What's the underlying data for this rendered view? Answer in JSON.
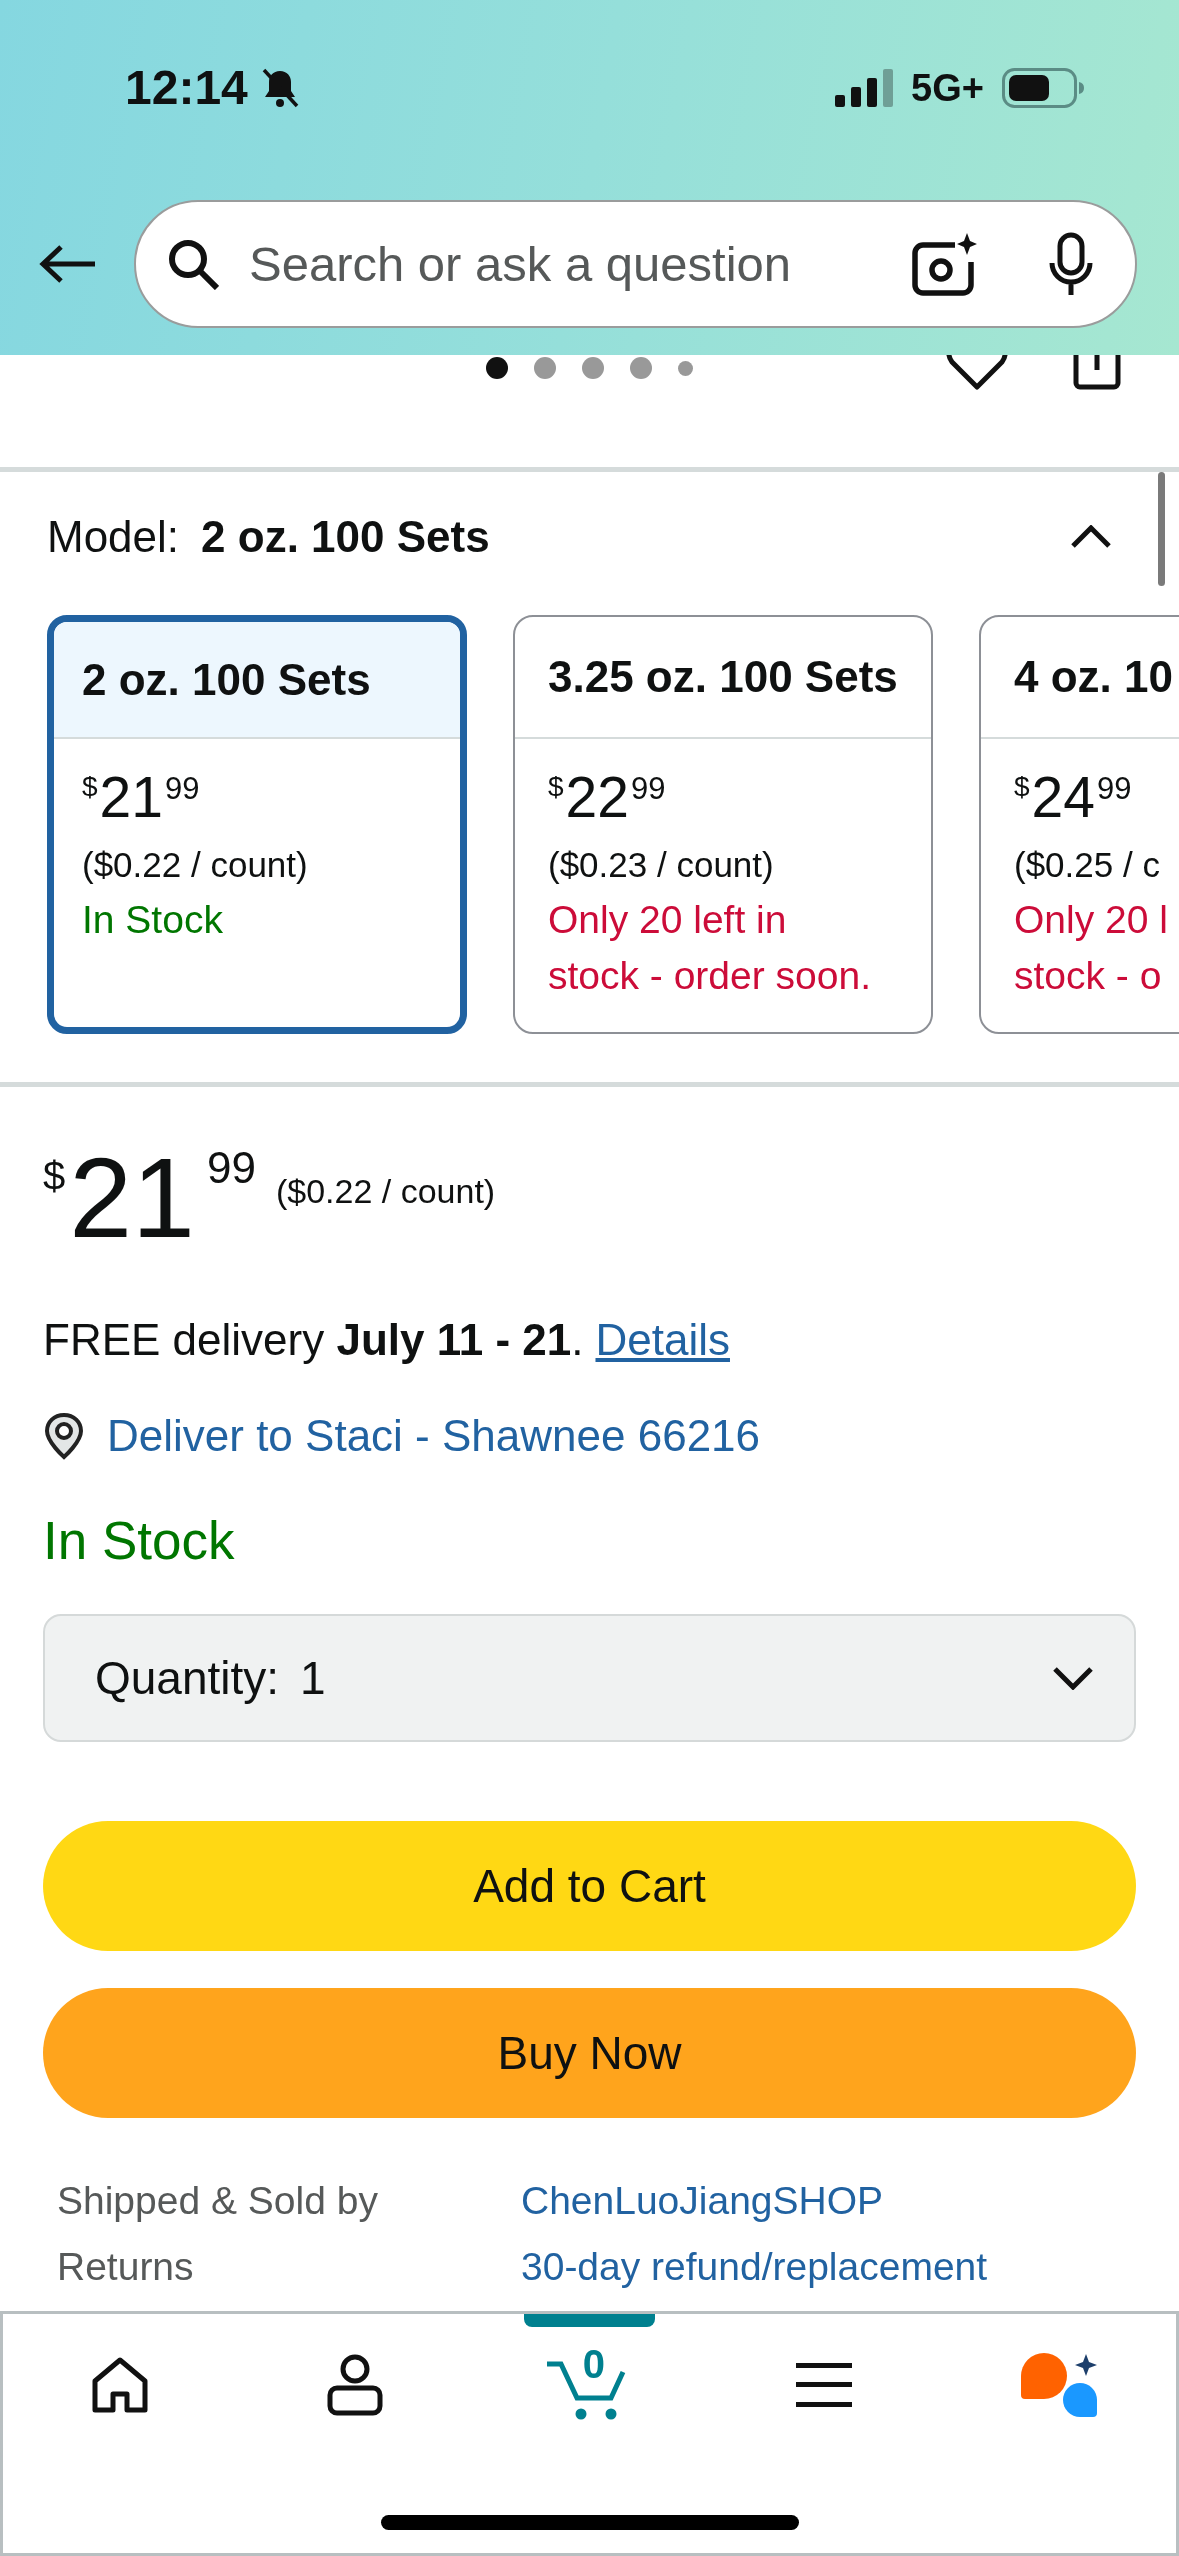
{
  "status_bar": {
    "time": "12:14",
    "network": "5G+"
  },
  "search_bar": {
    "placeholder": "Search or ask a question"
  },
  "image_carousel": {
    "dots": [
      {
        "selected": true
      },
      {
        "selected": false
      },
      {
        "selected": false
      },
      {
        "selected": false
      },
      {
        "selected": false
      }
    ]
  },
  "model_selector": {
    "label": "Model:",
    "value": "2 oz. 100 Sets",
    "expanded": true,
    "options": [
      {
        "name": "2 oz. 100 Sets",
        "currency": "$",
        "price_whole": "21",
        "price_fraction": "99",
        "unit_price": "($0.22 / count)",
        "availability": "In Stock",
        "low_stock": false,
        "selected": true
      },
      {
        "name": "3.25 oz. 100 Sets",
        "currency": "$",
        "price_whole": "22",
        "price_fraction": "99",
        "unit_price": "($0.23 / count)",
        "availability": "Only 20 left in\nstock - order soon.",
        "low_stock": true,
        "selected": false
      },
      {
        "name": "4 oz. 10",
        "currency": "$",
        "price_whole": "24",
        "price_fraction": "99",
        "unit_price": "($0.25 / c",
        "availability": "Only 20 l\nstock - o",
        "low_stock": true,
        "selected": false
      }
    ]
  },
  "price": {
    "currency": "$",
    "whole": "21",
    "fraction": "99",
    "unit_price": "($0.22 / count)"
  },
  "delivery": {
    "text": "FREE delivery **July 11 - 21**.",
    "link": "Details"
  },
  "deliver_to": "Deliver to Staci - Shawnee 66216",
  "availability": {
    "text": "In Stock",
    "low_stock": false
  },
  "quantity": {
    "label": "Quantity:",
    "value": "1"
  },
  "buttons": [
    {
      "label": "Add to Cart",
      "kind": "add_to_cart"
    },
    {
      "label": "Buy Now",
      "kind": "buy_now"
    }
  ],
  "seller_info": [
    {
      "label": "Shipped & Sold by",
      "value": "ChenLuoJiangSHOP"
    },
    {
      "label": "Returns",
      "value": "30-day refund/replacement"
    }
  ],
  "bottom_nav": [
    {
      "kind": "home",
      "selected": false
    },
    {
      "kind": "account",
      "selected": false
    },
    {
      "kind": "cart",
      "selected": true,
      "badge": "0"
    },
    {
      "kind": "menu",
      "selected": false
    },
    {
      "kind": "assistant",
      "selected": false
    }
  ]
}
